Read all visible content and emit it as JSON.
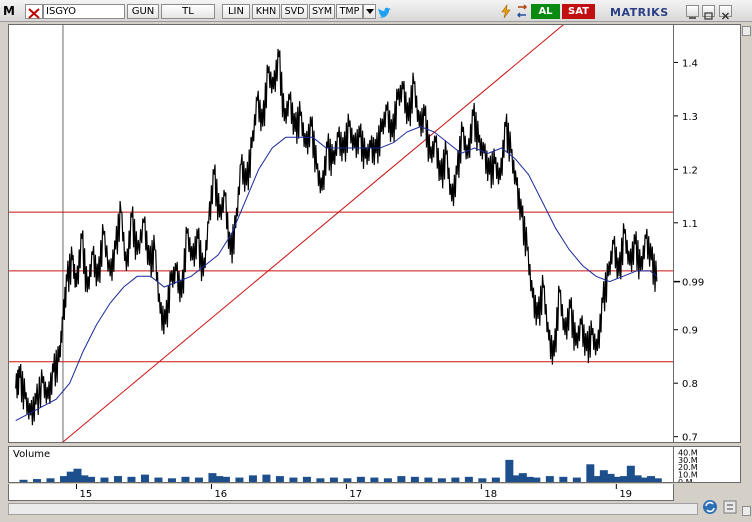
{
  "toolbar": {
    "logo": "M",
    "symbol": "ISGYO",
    "buttons": [
      "GUN",
      "TL",
      "LIN",
      "KHN",
      "SVD",
      "SYM",
      "TMP"
    ],
    "buy_label": "AL",
    "sell_label": "SAT",
    "brand": "MATRIKS"
  },
  "icons": {
    "close": "close-x-icon",
    "dropdown": "chevron-down-icon",
    "twitter": "twitter-bird-icon",
    "bolt": "lightning-icon",
    "swap": "swap-icon",
    "minimize": "minimize-icon",
    "maximize": "maximize-icon",
    "close_window": "window-close-icon"
  },
  "colors": {
    "price": "#000000",
    "moving_average": "#1a2a9a",
    "trendline": "#cc1010",
    "volume": "#1d4f8c",
    "buy": "#0a8a10",
    "sell": "#c01010"
  },
  "chart_data": {
    "type": "line",
    "x_labels": [
      "15",
      "16",
      "17",
      "18",
      "19"
    ],
    "y_ticks": [
      0.7,
      0.8,
      0.9,
      0.99,
      1.1,
      1.2,
      1.3,
      1.4
    ],
    "y_tick_labels": [
      "0.7",
      "0.8",
      "0.9",
      "0.99",
      "1.1",
      "1.2",
      "1.3",
      "1.4"
    ],
    "ylim": [
      0.69,
      1.47
    ],
    "last_price": 0.99,
    "horizontal_lines": [
      1.12,
      1.01,
      0.84
    ],
    "trendline": [
      [
        2014.9,
        0.69
      ],
      [
        2018.7,
        1.49
      ]
    ],
    "price": [
      [
        2014.55,
        0.79
      ],
      [
        2014.58,
        0.81
      ],
      [
        2014.62,
        0.77
      ],
      [
        2014.66,
        0.74
      ],
      [
        2014.7,
        0.76
      ],
      [
        2014.75,
        0.8
      ],
      [
        2014.79,
        0.77
      ],
      [
        2014.83,
        0.82
      ],
      [
        2014.87,
        0.84
      ],
      [
        2014.9,
        0.92
      ],
      [
        2014.93,
        0.99
      ],
      [
        2014.97,
        1.03
      ],
      [
        2015.0,
        0.98
      ],
      [
        2015.04,
        1.07
      ],
      [
        2015.08,
        0.97
      ],
      [
        2015.12,
        1.04
      ],
      [
        2015.16,
        0.99
      ],
      [
        2015.2,
        1.08
      ],
      [
        2015.25,
        1.0
      ],
      [
        2015.29,
        1.05
      ],
      [
        2015.33,
        1.12
      ],
      [
        2015.37,
        1.01
      ],
      [
        2015.41,
        1.11
      ],
      [
        2015.45,
        1.04
      ],
      [
        2015.5,
        1.1
      ],
      [
        2015.54,
        1.02
      ],
      [
        2015.58,
        1.05
      ],
      [
        2015.62,
        0.93
      ],
      [
        2015.66,
        0.91
      ],
      [
        2015.7,
        0.99
      ],
      [
        2015.74,
        1.01
      ],
      [
        2015.78,
        0.96
      ],
      [
        2015.82,
        1.08
      ],
      [
        2015.86,
        1.03
      ],
      [
        2015.9,
        1.07
      ],
      [
        2015.94,
        1.0
      ],
      [
        2015.98,
        1.1
      ],
      [
        2016.02,
        1.19
      ],
      [
        2016.06,
        1.11
      ],
      [
        2016.1,
        1.15
      ],
      [
        2016.14,
        1.04
      ],
      [
        2016.18,
        1.09
      ],
      [
        2016.22,
        1.21
      ],
      [
        2016.26,
        1.17
      ],
      [
        2016.3,
        1.24
      ],
      [
        2016.34,
        1.33
      ],
      [
        2016.38,
        1.28
      ],
      [
        2016.42,
        1.38
      ],
      [
        2016.46,
        1.35
      ],
      [
        2016.5,
        1.41
      ],
      [
        2016.54,
        1.29
      ],
      [
        2016.58,
        1.33
      ],
      [
        2016.62,
        1.27
      ],
      [
        2016.66,
        1.3
      ],
      [
        2016.7,
        1.24
      ],
      [
        2016.74,
        1.28
      ],
      [
        2016.78,
        1.2
      ],
      [
        2016.82,
        1.16
      ],
      [
        2016.86,
        1.24
      ],
      [
        2016.9,
        1.21
      ],
      [
        2016.94,
        1.26
      ],
      [
        2016.98,
        1.23
      ],
      [
        2017.02,
        1.28
      ],
      [
        2017.06,
        1.24
      ],
      [
        2017.1,
        1.26
      ],
      [
        2017.14,
        1.22
      ],
      [
        2017.18,
        1.24
      ],
      [
        2017.22,
        1.23
      ],
      [
        2017.26,
        1.27
      ],
      [
        2017.3,
        1.31
      ],
      [
        2017.34,
        1.26
      ],
      [
        2017.38,
        1.33
      ],
      [
        2017.42,
        1.35
      ],
      [
        2017.46,
        1.29
      ],
      [
        2017.5,
        1.36
      ],
      [
        2017.54,
        1.28
      ],
      [
        2017.58,
        1.3
      ],
      [
        2017.62,
        1.22
      ],
      [
        2017.66,
        1.25
      ],
      [
        2017.7,
        1.18
      ],
      [
        2017.74,
        1.23
      ],
      [
        2017.78,
        1.14
      ],
      [
        2017.82,
        1.19
      ],
      [
        2017.86,
        1.27
      ],
      [
        2017.9,
        1.22
      ],
      [
        2017.94,
        1.3
      ],
      [
        2017.98,
        1.25
      ],
      [
        2018.02,
        1.23
      ],
      [
        2018.06,
        1.19
      ],
      [
        2018.1,
        1.21
      ],
      [
        2018.14,
        1.18
      ],
      [
        2018.18,
        1.28
      ],
      [
        2018.22,
        1.23
      ],
      [
        2018.26,
        1.17
      ],
      [
        2018.3,
        1.11
      ],
      [
        2018.34,
        1.05
      ],
      [
        2018.38,
        0.96
      ],
      [
        2018.42,
        0.92
      ],
      [
        2018.46,
        0.98
      ],
      [
        2018.5,
        0.88
      ],
      [
        2018.54,
        0.85
      ],
      [
        2018.58,
        0.97
      ],
      [
        2018.62,
        0.89
      ],
      [
        2018.66,
        0.94
      ],
      [
        2018.7,
        0.87
      ],
      [
        2018.74,
        0.91
      ],
      [
        2018.78,
        0.86
      ],
      [
        2018.82,
        0.89
      ],
      [
        2018.86,
        0.86
      ],
      [
        2018.9,
        0.95
      ],
      [
        2018.94,
        1.0
      ],
      [
        2018.98,
        1.06
      ],
      [
        2019.02,
        1.0
      ],
      [
        2019.06,
        1.08
      ],
      [
        2019.1,
        1.02
      ],
      [
        2019.14,
        1.06
      ],
      [
        2019.18,
        1.01
      ],
      [
        2019.22,
        1.07
      ],
      [
        2019.26,
        1.03
      ],
      [
        2019.3,
        0.99
      ]
    ],
    "moving_average": [
      [
        2014.55,
        0.73
      ],
      [
        2014.7,
        0.75
      ],
      [
        2014.85,
        0.77
      ],
      [
        2014.95,
        0.8
      ],
      [
        2015.05,
        0.86
      ],
      [
        2015.15,
        0.91
      ],
      [
        2015.25,
        0.95
      ],
      [
        2015.35,
        0.98
      ],
      [
        2015.45,
        1.0
      ],
      [
        2015.55,
        1.0
      ],
      [
        2015.65,
        0.98
      ],
      [
        2015.75,
        0.99
      ],
      [
        2015.85,
        1.0
      ],
      [
        2015.95,
        1.02
      ],
      [
        2016.05,
        1.04
      ],
      [
        2016.15,
        1.08
      ],
      [
        2016.25,
        1.14
      ],
      [
        2016.35,
        1.2
      ],
      [
        2016.45,
        1.24
      ],
      [
        2016.55,
        1.26
      ],
      [
        2016.65,
        1.26
      ],
      [
        2016.75,
        1.26
      ],
      [
        2016.85,
        1.24
      ],
      [
        2016.95,
        1.24
      ],
      [
        2017.05,
        1.24
      ],
      [
        2017.15,
        1.24
      ],
      [
        2017.25,
        1.24
      ],
      [
        2017.35,
        1.25
      ],
      [
        2017.45,
        1.27
      ],
      [
        2017.55,
        1.28
      ],
      [
        2017.65,
        1.27
      ],
      [
        2017.75,
        1.25
      ],
      [
        2017.85,
        1.23
      ],
      [
        2017.95,
        1.24
      ],
      [
        2018.05,
        1.23
      ],
      [
        2018.15,
        1.24
      ],
      [
        2018.25,
        1.22
      ],
      [
        2018.35,
        1.19
      ],
      [
        2018.45,
        1.14
      ],
      [
        2018.55,
        1.09
      ],
      [
        2018.65,
        1.05
      ],
      [
        2018.75,
        1.02
      ],
      [
        2018.85,
        1.0
      ],
      [
        2018.95,
        0.99
      ],
      [
        2019.05,
        1.0
      ],
      [
        2019.15,
        1.01
      ],
      [
        2019.25,
        1.01
      ],
      [
        2019.3,
        1.0
      ]
    ],
    "volume_label": "Volume",
    "volume_ticks": [
      0,
      10,
      20,
      30,
      40
    ],
    "volume_tick_labels": [
      "0.M",
      "10.M",
      "20.M",
      "30.M",
      "40.M"
    ],
    "volume": [
      [
        2014.6,
        3
      ],
      [
        2014.7,
        4
      ],
      [
        2014.8,
        5
      ],
      [
        2014.9,
        8
      ],
      [
        2014.95,
        14
      ],
      [
        2015.0,
        18
      ],
      [
        2015.05,
        9
      ],
      [
        2015.1,
        7
      ],
      [
        2015.2,
        6
      ],
      [
        2015.3,
        8
      ],
      [
        2015.4,
        7
      ],
      [
        2015.5,
        10
      ],
      [
        2015.6,
        6
      ],
      [
        2015.7,
        5
      ],
      [
        2015.8,
        7
      ],
      [
        2015.9,
        6
      ],
      [
        2016.0,
        12
      ],
      [
        2016.05,
        8
      ],
      [
        2016.1,
        7
      ],
      [
        2016.2,
        6
      ],
      [
        2016.3,
        9
      ],
      [
        2016.4,
        10
      ],
      [
        2016.5,
        8
      ],
      [
        2016.6,
        6
      ],
      [
        2016.7,
        7
      ],
      [
        2016.8,
        5
      ],
      [
        2016.9,
        6
      ],
      [
        2017.0,
        5
      ],
      [
        2017.1,
        7
      ],
      [
        2017.2,
        6
      ],
      [
        2017.3,
        5
      ],
      [
        2017.4,
        8
      ],
      [
        2017.5,
        7
      ],
      [
        2017.6,
        6
      ],
      [
        2017.7,
        5
      ],
      [
        2017.8,
        6
      ],
      [
        2017.9,
        7
      ],
      [
        2018.0,
        5
      ],
      [
        2018.1,
        6
      ],
      [
        2018.2,
        30
      ],
      [
        2018.25,
        9
      ],
      [
        2018.3,
        12
      ],
      [
        2018.35,
        7
      ],
      [
        2018.4,
        6
      ],
      [
        2018.5,
        8
      ],
      [
        2018.6,
        7
      ],
      [
        2018.7,
        6
      ],
      [
        2018.8,
        24
      ],
      [
        2018.85,
        8
      ],
      [
        2018.9,
        16
      ],
      [
        2018.95,
        11
      ],
      [
        2019.0,
        7
      ],
      [
        2019.05,
        8
      ],
      [
        2019.1,
        22
      ],
      [
        2019.15,
        9
      ],
      [
        2019.2,
        6
      ],
      [
        2019.25,
        8
      ],
      [
        2019.3,
        5
      ]
    ]
  }
}
